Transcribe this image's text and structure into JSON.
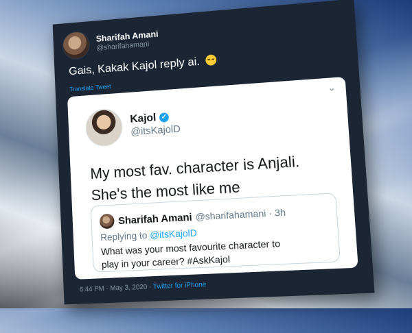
{
  "outer_tweet": {
    "display_name": "Sharifah Amani",
    "handle": "@sharifahamani",
    "text": "Gais, Kakak Kajol reply ai.",
    "emoji": "smiling-face-emoji",
    "translate_label": "Translate Tweet",
    "timestamp": "6:44 PM · May 3, 2020 ·",
    "source": "Twitter for iPhone"
  },
  "quoted_tweet": {
    "display_name": "Kajol",
    "handle": "@itsKajolD",
    "verified": true,
    "text_line1": "My most fav. character is Anjali.",
    "text_line2": "She's the most like me",
    "chevron": "chevron-down-icon"
  },
  "reply_context": {
    "display_name": "Sharifah Amani",
    "handle_time": "@sharifahamani · 3h",
    "replying_prefix": "Replying to",
    "replying_to": "@itsKajolD",
    "text_line1": "What was your most favourite character to",
    "text_line2": "play in your career? #AskKajol"
  },
  "colors": {
    "tweet_bg": "#1b2533",
    "card_bg": "#ffffff",
    "link": "#1da1f2",
    "muted": "#8899a6"
  }
}
